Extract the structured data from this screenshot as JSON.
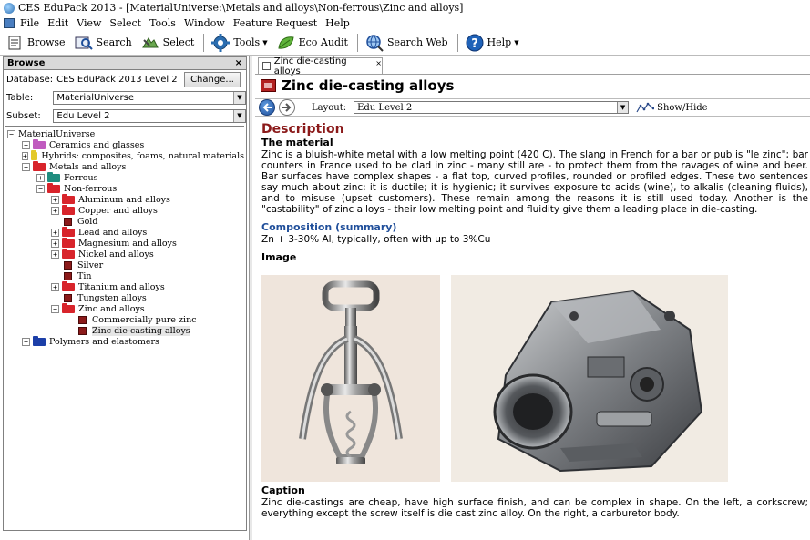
{
  "window": {
    "title": "CES EduPack 2013 - [MaterialUniverse:\\Metals and alloys\\Non-ferrous\\Zinc and alloys]"
  },
  "menu": [
    "File",
    "Edit",
    "View",
    "Select",
    "Tools",
    "Window",
    "Feature Request",
    "Help"
  ],
  "toolbar": {
    "browse": "Browse",
    "search": "Search",
    "select": "Select",
    "tools": "Tools",
    "eco_audit": "Eco Audit",
    "search_web": "Search Web",
    "help": "Help"
  },
  "browse_panel": {
    "title": "Browse",
    "close": "×",
    "database_label": "Database:",
    "database_value": "CES EduPack 2013 Level 2",
    "change_button": "Change...",
    "table_label": "Table:",
    "table_value": "MaterialUniverse",
    "subset_label": "Subset:",
    "subset_value": "Edu Level 2",
    "tree": [
      {
        "label": "MaterialUniverse",
        "indent": 0,
        "exp": "minus",
        "icon": "none"
      },
      {
        "label": "Ceramics and glasses",
        "indent": 1,
        "exp": "plus",
        "icon": "folder",
        "color": "#c05bbf"
      },
      {
        "label": "Hybrids: composites, foams, natural materials",
        "indent": 1,
        "exp": "plus",
        "icon": "folder",
        "color": "#e3c92a"
      },
      {
        "label": "Metals and alloys",
        "indent": 1,
        "exp": "minus",
        "icon": "folder",
        "color": "#d8242b"
      },
      {
        "label": "Ferrous",
        "indent": 2,
        "exp": "plus",
        "icon": "folder",
        "color": "#1f8d7f"
      },
      {
        "label": "Non-ferrous",
        "indent": 2,
        "exp": "minus",
        "icon": "folder",
        "color": "#d8242b"
      },
      {
        "label": "Aluminum and alloys",
        "indent": 3,
        "exp": "plus",
        "icon": "folder",
        "color": "#d8242b"
      },
      {
        "label": "Copper and alloys",
        "indent": 3,
        "exp": "plus",
        "icon": "folder",
        "color": "#d8242b"
      },
      {
        "label": "Gold",
        "indent": 3,
        "exp": "none",
        "icon": "leaf"
      },
      {
        "label": "Lead and alloys",
        "indent": 3,
        "exp": "plus",
        "icon": "folder",
        "color": "#d8242b"
      },
      {
        "label": "Magnesium and alloys",
        "indent": 3,
        "exp": "plus",
        "icon": "folder",
        "color": "#d8242b"
      },
      {
        "label": "Nickel and alloys",
        "indent": 3,
        "exp": "plus",
        "icon": "folder",
        "color": "#d8242b"
      },
      {
        "label": "Silver",
        "indent": 3,
        "exp": "none",
        "icon": "leaf"
      },
      {
        "label": "Tin",
        "indent": 3,
        "exp": "none",
        "icon": "leaf"
      },
      {
        "label": "Titanium and alloys",
        "indent": 3,
        "exp": "plus",
        "icon": "folder",
        "color": "#d8242b"
      },
      {
        "label": "Tungsten alloys",
        "indent": 3,
        "exp": "none",
        "icon": "leaf"
      },
      {
        "label": "Zinc and alloys",
        "indent": 3,
        "exp": "minus",
        "icon": "folder",
        "color": "#d8242b"
      },
      {
        "label": "Commercially pure zinc",
        "indent": 4,
        "exp": "none",
        "icon": "leaf"
      },
      {
        "label": "Zinc die-casting alloys",
        "indent": 4,
        "exp": "none",
        "icon": "leaf",
        "selected": true
      },
      {
        "label": "Polymers and elastomers",
        "indent": 1,
        "exp": "plus",
        "icon": "folder",
        "color": "#1c3fa8"
      }
    ]
  },
  "datasheet": {
    "tab_label": "Zinc die-casting alloys",
    "tab_close": "×",
    "title": "Zinc die-casting alloys",
    "layout_label": "Layout:",
    "layout_value": "Edu Level 2",
    "show_hide": "Show/Hide",
    "description_heading": "Description",
    "material_heading": "The material",
    "material_text": "Zinc is a bluish-white metal with a low melting point (420 C). The slang in French for a bar or pub is \"le zinc\"; bar counters in France used to be clad in zinc - many still are - to protect them from the ravages of wine and beer. Bar surfaces have complex shapes - a flat top, curved profiles, rounded or profiled edges. These two sentences say much about zinc: it is ductile; it is hygienic; it survives exposure to acids (wine), to alkalis (cleaning fluids), and to misuse (upset customers). These remain among the reasons it is still used today. Another is the \"castability\" of zinc alloys - their low melting point and fluidity give them a leading place in die-casting.",
    "composition_heading": "Composition (summary)",
    "composition_text": "Zn + 3-30% Al, typically, often with up to 3%Cu",
    "image_heading": "Image",
    "caption_heading": "Caption",
    "caption_text": "Zinc die-castings are cheap, have high surface finish, and can be complex in shape. On the left, a corkscrew; everything except the screw itself is die cast zinc alloy. On the right, a carburetor body."
  },
  "colors": {
    "description_heading": "#8b1a1a",
    "composition_heading": "#1f4e9a",
    "nav_back": "#1f4e9a"
  }
}
